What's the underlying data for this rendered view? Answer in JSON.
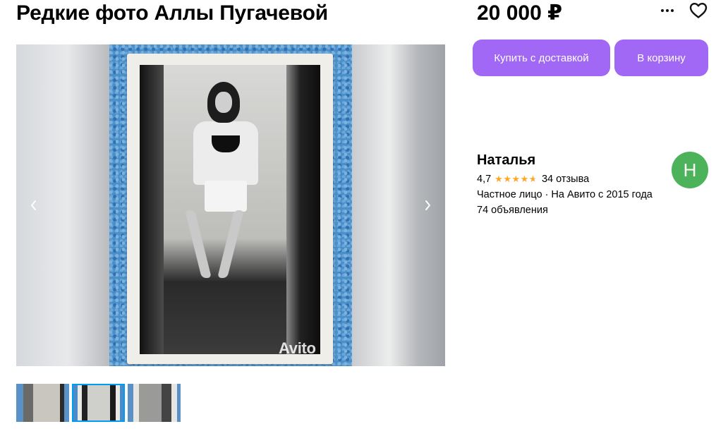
{
  "listing": {
    "title": "Редкие фото Аллы Пугачевой",
    "price": "20 000 ₽"
  },
  "actions": {
    "more_icon": "more-dots-icon",
    "favorite_icon": "heart-icon",
    "buy_with_delivery": "Купить с доставкой",
    "add_to_cart": "В корзину",
    "accent_color": "#a168f5"
  },
  "gallery": {
    "watermark": "Avito",
    "prev_icon": "chevron-left-icon",
    "next_icon": "chevron-right-icon",
    "thumbnails_count": 3,
    "active_thumbnail": 2,
    "active_border_color": "#009cf0"
  },
  "seller": {
    "name": "Наталья",
    "rating": "4,7",
    "stars": 4.7,
    "reviews": "34 отзыва",
    "meta": "Частное лицо · На Авито с 2015 года",
    "listings": "74 объявления",
    "avatar_letter": "Н",
    "avatar_color": "#4cb35a"
  }
}
